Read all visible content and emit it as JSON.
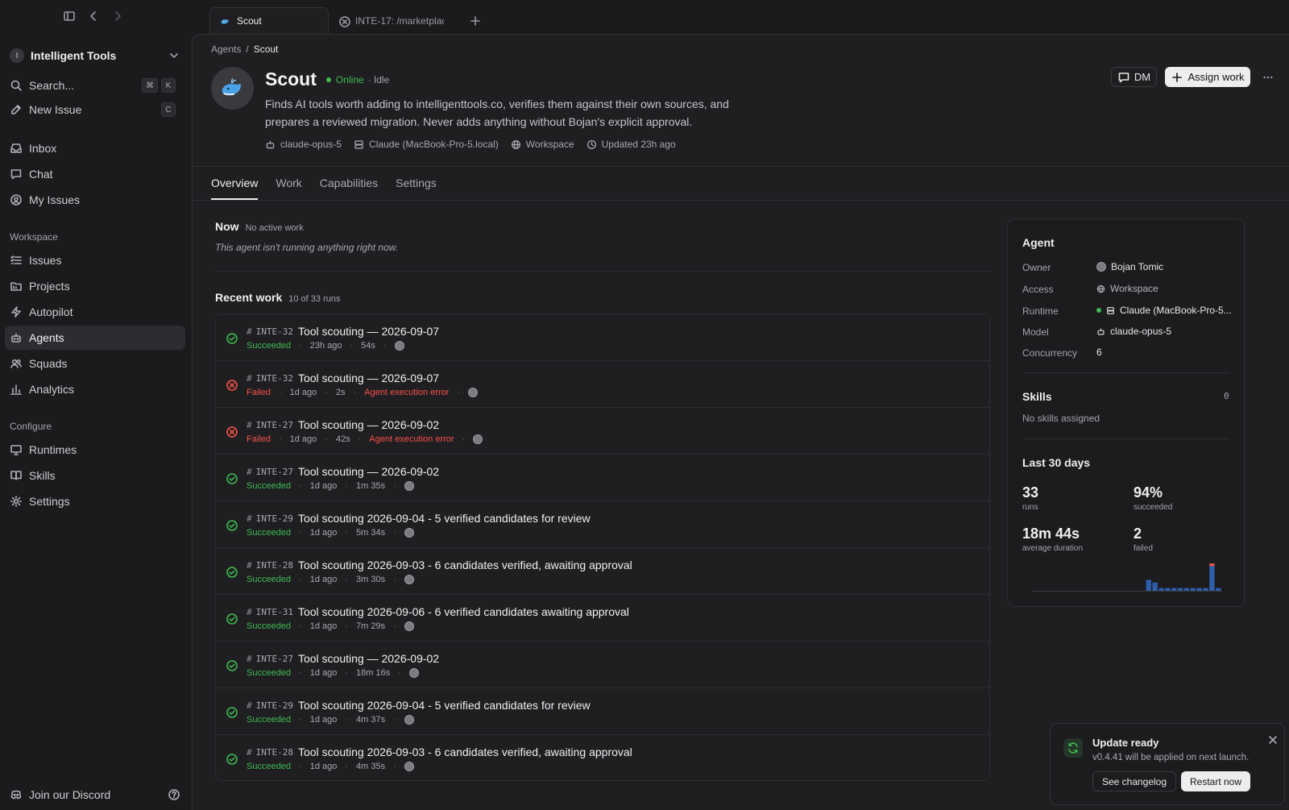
{
  "sidebar": {
    "workspace_initial": "I",
    "workspace_name": "Intelligent Tools",
    "search_label": "Search...",
    "search_kbd1": "⌘",
    "search_kbd2": "K",
    "new_issue_label": "New Issue",
    "new_issue_kbd": "C",
    "primary": [
      {
        "label": "Inbox",
        "icon": "inbox-icon"
      },
      {
        "label": "Chat",
        "icon": "chat-icon"
      },
      {
        "label": "My Issues",
        "icon": "user-circle-icon"
      }
    ],
    "workspace_heading": "Workspace",
    "workspace_items": [
      {
        "label": "Issues",
        "icon": "list-icon"
      },
      {
        "label": "Projects",
        "icon": "folder-icon"
      },
      {
        "label": "Autopilot",
        "icon": "bolt-icon"
      },
      {
        "label": "Agents",
        "icon": "bot-icon",
        "active": true
      },
      {
        "label": "Squads",
        "icon": "users-icon"
      },
      {
        "label": "Analytics",
        "icon": "bar-chart-icon"
      }
    ],
    "configure_heading": "Configure",
    "configure_items": [
      {
        "label": "Runtimes",
        "icon": "monitor-icon"
      },
      {
        "label": "Skills",
        "icon": "book-icon"
      },
      {
        "label": "Settings",
        "icon": "gear-icon"
      }
    ],
    "discord_label": "Join our Discord"
  },
  "tabs": [
    {
      "label": "Scout",
      "active": true
    },
    {
      "label": "INTE-17: /marketplac",
      "active": false
    }
  ],
  "breadcrumb": {
    "parent": "Agents",
    "separator": "/",
    "current": "Scout"
  },
  "agent": {
    "name": "Scout",
    "status": "Online",
    "state": "· Idle",
    "description": "Finds AI tools worth adding to intelligenttools.co, verifies them against their own sources, and prepares a reviewed migration. Never adds anything without Bojan's explicit approval.",
    "meta": {
      "model": "claude-opus-5",
      "runtime": "Claude (MacBook-Pro-5.local)",
      "access": "Workspace",
      "updated": "Updated 23h ago"
    }
  },
  "actions": {
    "dm": "DM",
    "assign": "Assign work"
  },
  "subtabs": [
    "Overview",
    "Work",
    "Capabilities",
    "Settings"
  ],
  "now": {
    "heading": "Now",
    "tag": "No active work",
    "message": "This agent isn't running anything right now."
  },
  "recent": {
    "heading": "Recent work",
    "count": "10 of 33 runs",
    "runs": [
      {
        "issue": "INTE-32",
        "title": "Tool scouting — 2026-09-07",
        "status": "Succeeded",
        "ok": true,
        "age": "23h ago",
        "duration": "54s",
        "error": ""
      },
      {
        "issue": "INTE-32",
        "title": "Tool scouting — 2026-09-07",
        "status": "Failed",
        "ok": false,
        "age": "1d ago",
        "duration": "2s",
        "error": "Agent execution error"
      },
      {
        "issue": "INTE-27",
        "title": "Tool scouting — 2026-09-02",
        "status": "Failed",
        "ok": false,
        "age": "1d ago",
        "duration": "42s",
        "error": "Agent execution error"
      },
      {
        "issue": "INTE-27",
        "title": "Tool scouting — 2026-09-02",
        "status": "Succeeded",
        "ok": true,
        "age": "1d ago",
        "duration": "1m 35s",
        "error": ""
      },
      {
        "issue": "INTE-29",
        "title": "Tool scouting 2026-09-04 - 5 verified candidates for review",
        "status": "Succeeded",
        "ok": true,
        "age": "1d ago",
        "duration": "5m 34s",
        "error": ""
      },
      {
        "issue": "INTE-28",
        "title": "Tool scouting 2026-09-03 - 6 candidates verified, awaiting approval",
        "status": "Succeeded",
        "ok": true,
        "age": "1d ago",
        "duration": "3m 30s",
        "error": ""
      },
      {
        "issue": "INTE-31",
        "title": "Tool scouting 2026-09-06 - 6 verified candidates awaiting approval",
        "status": "Succeeded",
        "ok": true,
        "age": "1d ago",
        "duration": "7m 29s",
        "error": ""
      },
      {
        "issue": "INTE-27",
        "title": "Tool scouting — 2026-09-02",
        "status": "Succeeded",
        "ok": true,
        "age": "1d ago",
        "duration": "18m 16s",
        "error": ""
      },
      {
        "issue": "INTE-29",
        "title": "Tool scouting 2026-09-04 - 5 verified candidates for review",
        "status": "Succeeded",
        "ok": true,
        "age": "1d ago",
        "duration": "4m 37s",
        "error": ""
      },
      {
        "issue": "INTE-28",
        "title": "Tool scouting 2026-09-03 - 6 candidates verified, awaiting approval",
        "status": "Succeeded",
        "ok": true,
        "age": "1d ago",
        "duration": "4m 35s",
        "error": ""
      }
    ]
  },
  "card": {
    "agent_heading": "Agent",
    "owner_label": "Owner",
    "owner": "Bojan Tomic",
    "access_label": "Access",
    "access": "Workspace",
    "runtime_label": "Runtime",
    "runtime": "Claude (MacBook-Pro-5...",
    "model_label": "Model",
    "model": "claude-opus-5",
    "concurrency_label": "Concurrency",
    "concurrency": "6",
    "skills_heading": "Skills",
    "skills_count": "0",
    "skills_empty": "No skills assigned",
    "period_heading": "Last 30 days",
    "runs": "33",
    "runs_label": "runs",
    "success": "94%",
    "success_label": "succeeded",
    "avg": "18m 44s",
    "avg_label": "average duration",
    "failed": "2",
    "failed_label": "failed",
    "colors": {
      "success_bar": "#2f5fa8",
      "fail_bar": "#e5534b"
    }
  },
  "chart_data": {
    "type": "bar",
    "stacked": true,
    "series": [
      {
        "values": [
          0,
          0,
          0,
          0,
          0,
          0,
          0,
          0,
          0,
          0,
          0,
          0,
          0,
          0,
          0,
          0,
          0,
          0,
          4,
          3,
          1,
          1,
          1,
          1,
          1,
          1,
          1,
          1,
          9,
          1
        ]
      },
      {
        "values": [
          0,
          0,
          0,
          0,
          0,
          0,
          0,
          0,
          0,
          0,
          0,
          0,
          0,
          0,
          0,
          0,
          0,
          0,
          0,
          0,
          0,
          0,
          0,
          0,
          0,
          0,
          0,
          0,
          1,
          0
        ]
      }
    ]
  },
  "toast": {
    "title": "Update ready",
    "message": "v0.4.41 will be applied on next launch.",
    "changelog": "See changelog",
    "restart": "Restart now"
  }
}
